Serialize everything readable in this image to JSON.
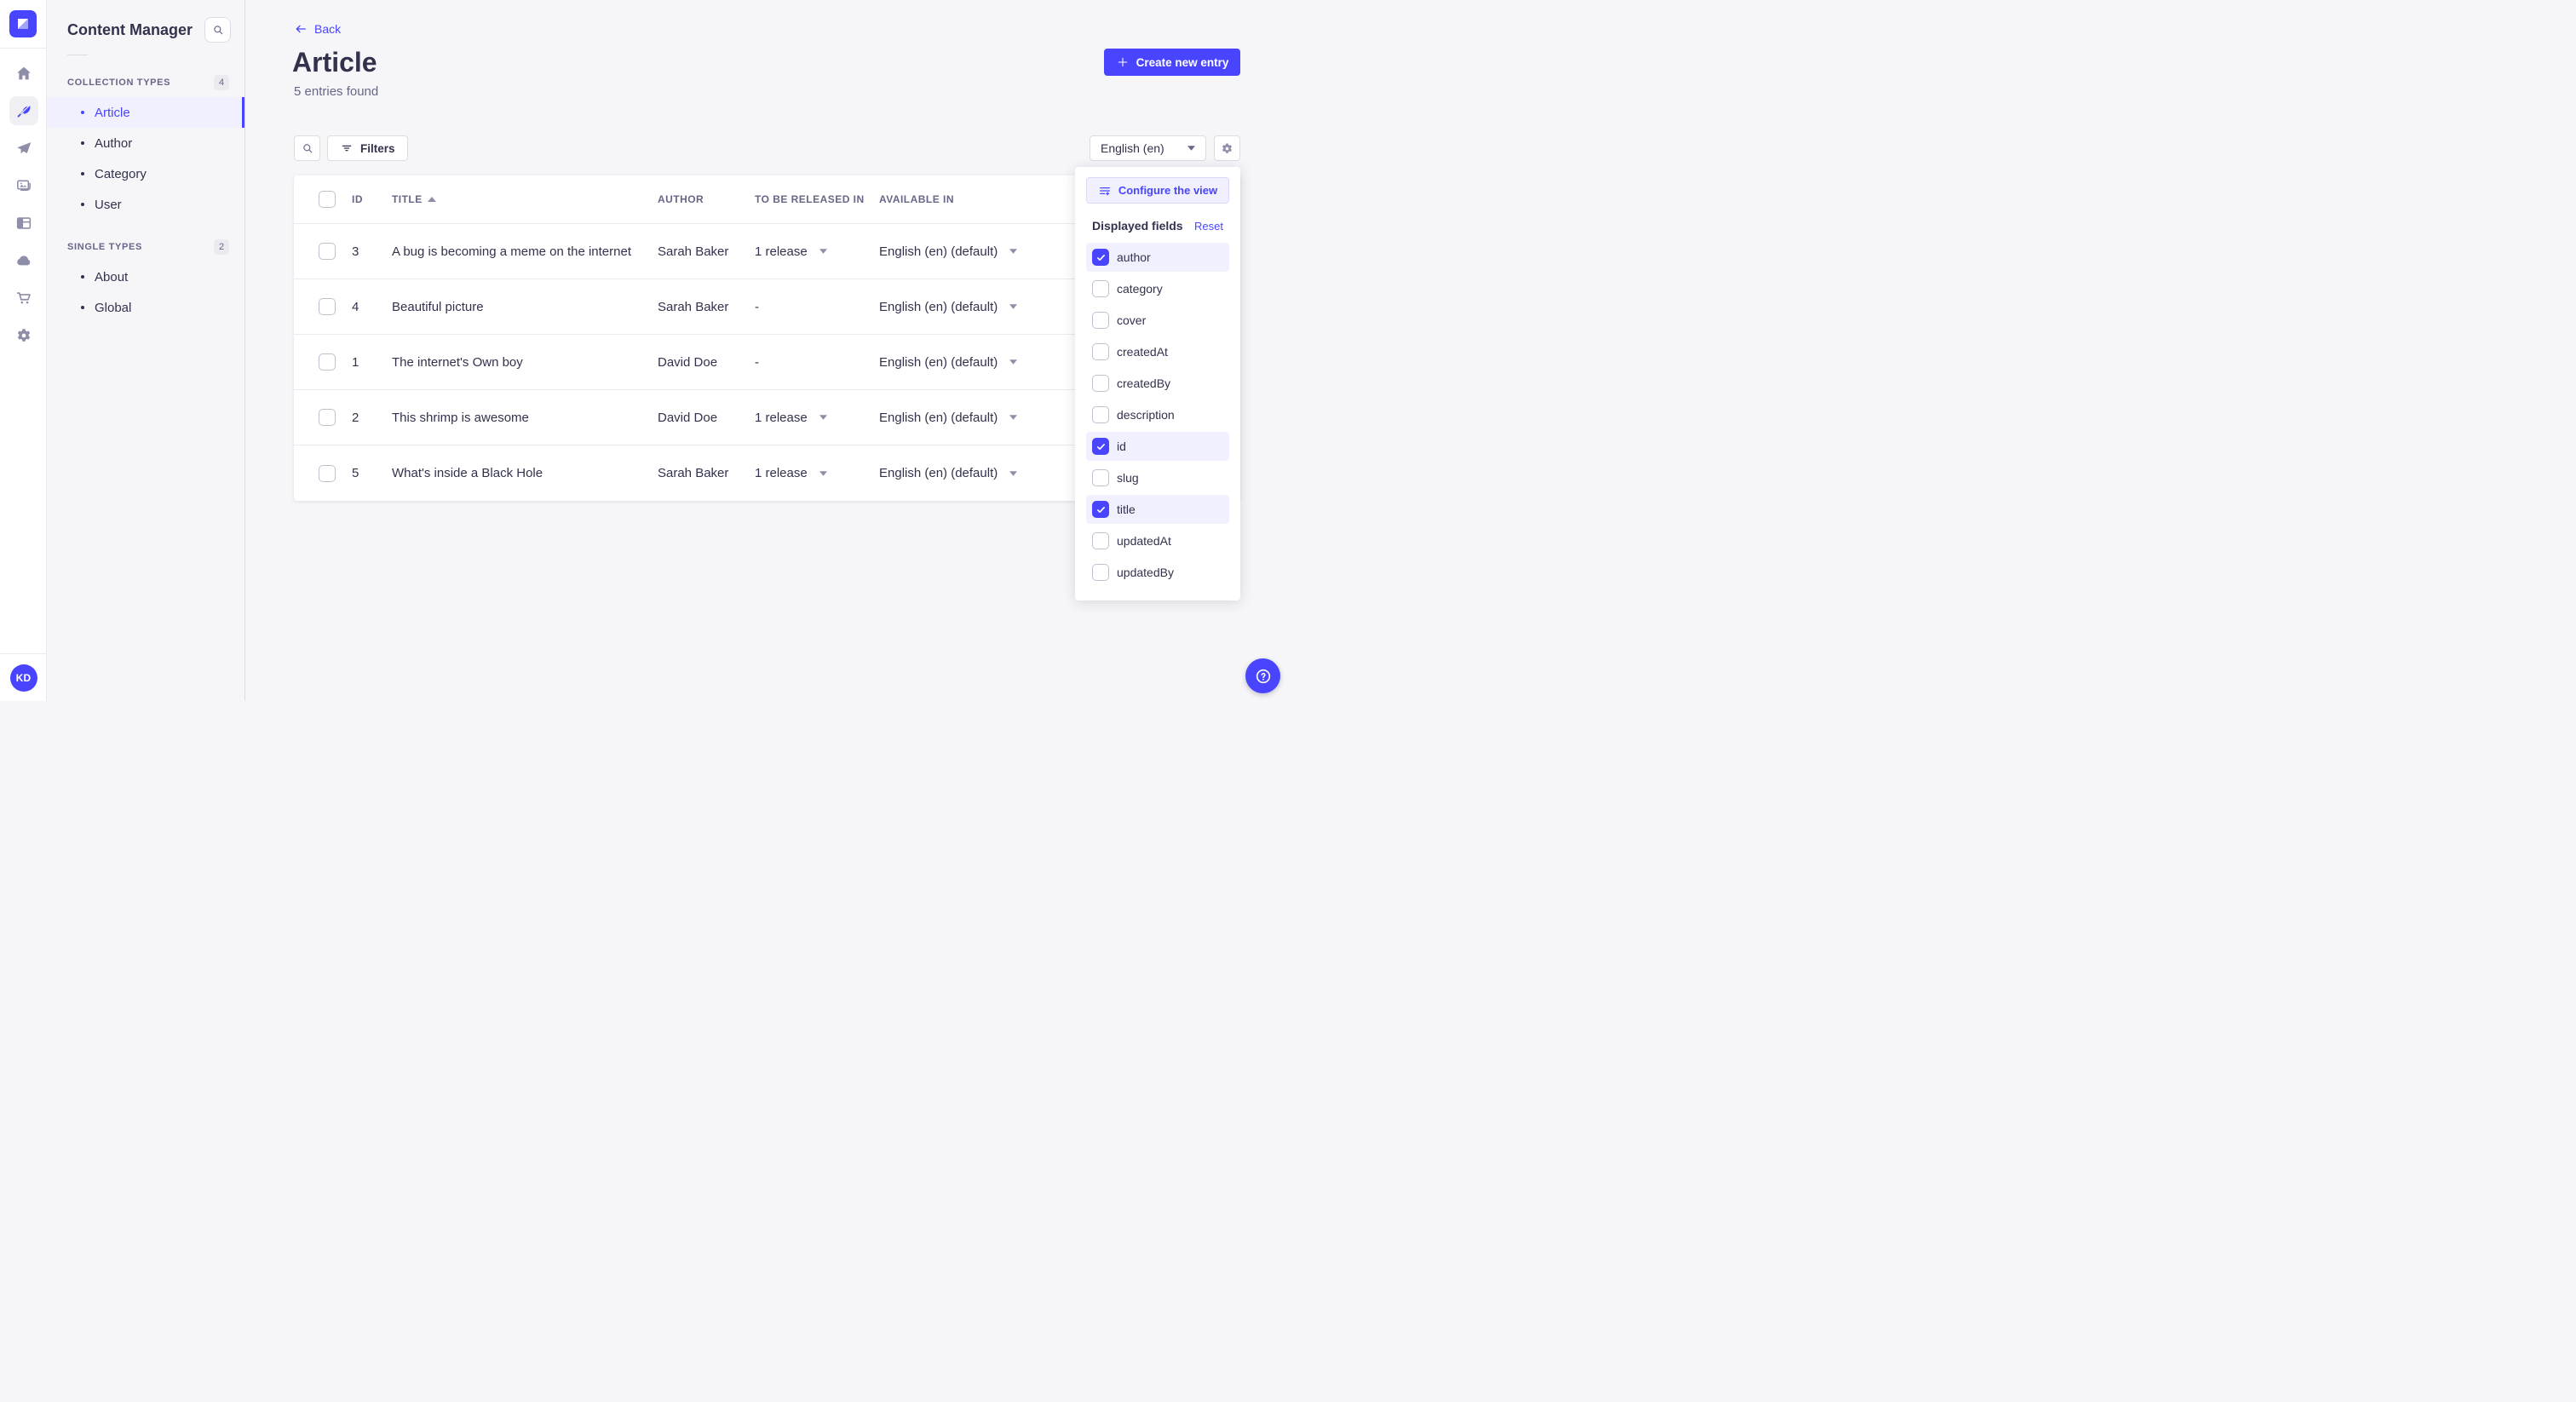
{
  "app": {
    "logo": "strapi-logo",
    "avatar_initials": "KD"
  },
  "rail": {
    "items": [
      {
        "icon": "home-icon",
        "active": false
      },
      {
        "icon": "content-manager-icon",
        "active": true
      },
      {
        "icon": "releases-icon",
        "active": false
      },
      {
        "icon": "media-library-icon",
        "active": false
      },
      {
        "icon": "content-type-builder-icon",
        "active": false
      },
      {
        "icon": "cloud-icon",
        "active": false
      },
      {
        "icon": "marketplace-icon",
        "active": false
      },
      {
        "icon": "settings-icon",
        "active": false
      }
    ]
  },
  "sidebar": {
    "title": "Content Manager",
    "search_icon": "search-icon",
    "sections": [
      {
        "label": "COLLECTION TYPES",
        "count": "4",
        "items": [
          {
            "label": "Article",
            "active": true
          },
          {
            "label": "Author",
            "active": false
          },
          {
            "label": "Category",
            "active": false
          },
          {
            "label": "User",
            "active": false
          }
        ]
      },
      {
        "label": "SINGLE TYPES",
        "count": "2",
        "items": [
          {
            "label": "About",
            "active": false
          },
          {
            "label": "Global",
            "active": false
          }
        ]
      }
    ]
  },
  "header": {
    "back_label": "Back",
    "title": "Article",
    "subtitle": "5 entries found",
    "create_button_label": "Create new entry"
  },
  "toolbar": {
    "filters_label": "Filters",
    "locale_selected": "English (en)"
  },
  "table": {
    "columns": {
      "id": "ID",
      "title": "TITLE",
      "author": "AUTHOR",
      "releases": "TO BE RELEASED IN",
      "available": "AVAILABLE IN"
    },
    "sort": {
      "column": "TITLE",
      "direction": "ascending"
    },
    "rows": [
      {
        "id": "3",
        "title": "A bug is becoming a meme on the internet",
        "author": "Sarah Baker",
        "releases": "1 release",
        "available": "English (en) (default)"
      },
      {
        "id": "4",
        "title": "Beautiful picture",
        "author": "Sarah Baker",
        "releases": "-",
        "available": "English (en) (default)"
      },
      {
        "id": "1",
        "title": "The internet's Own boy",
        "author": "David Doe",
        "releases": "-",
        "available": "English (en) (default)"
      },
      {
        "id": "2",
        "title": "This shrimp is awesome",
        "author": "David Doe",
        "releases": "1 release",
        "available": "English (en) (default)"
      },
      {
        "id": "5",
        "title": "What's inside a Black Hole",
        "author": "Sarah Baker",
        "releases": "1 release",
        "available": "English (en) (default)"
      }
    ]
  },
  "popover": {
    "configure_button_label": "Configure the view",
    "fields_title": "Displayed fields",
    "reset_label": "Reset",
    "fields": [
      {
        "label": "author",
        "checked": true
      },
      {
        "label": "category",
        "checked": false
      },
      {
        "label": "cover",
        "checked": false
      },
      {
        "label": "createdAt",
        "checked": false
      },
      {
        "label": "createdBy",
        "checked": false
      },
      {
        "label": "description",
        "checked": false
      },
      {
        "label": "id",
        "checked": true
      },
      {
        "label": "slug",
        "checked": false
      },
      {
        "label": "title",
        "checked": true
      },
      {
        "label": "updatedAt",
        "checked": false
      },
      {
        "label": "updatedBy",
        "checked": false
      }
    ]
  },
  "colors": {
    "primary": "#4945ff",
    "primary_light": "#f0f0ff",
    "primary_border": "#d9d8ff",
    "text_dark": "#32324d",
    "text_muted": "#666687",
    "text_subtle": "#8e8ea9",
    "surface": "#ffffff",
    "background": "#f6f6f9",
    "border": "#dcdce4",
    "divider": "#eaeaef"
  }
}
